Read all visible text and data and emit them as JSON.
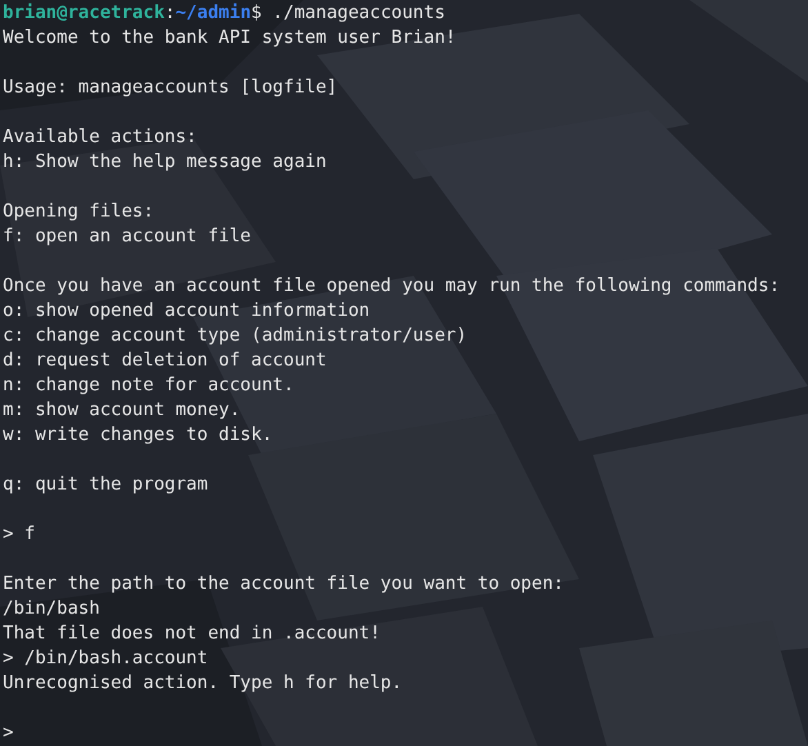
{
  "terminal": {
    "lines": [
      {
        "kind": "prompt",
        "user": "brian@racetrack",
        "separator": ":",
        "path": "~/admin",
        "symbol": "$",
        "command": " ./manageaccounts"
      },
      {
        "kind": "output",
        "text": "Welcome to the bank API system user Brian!"
      },
      {
        "kind": "blank"
      },
      {
        "kind": "output",
        "text": "Usage: manageaccounts [logfile]"
      },
      {
        "kind": "blank"
      },
      {
        "kind": "output",
        "text": "Available actions:"
      },
      {
        "kind": "output",
        "text": "h: Show the help message again"
      },
      {
        "kind": "blank"
      },
      {
        "kind": "output",
        "text": "Opening files:"
      },
      {
        "kind": "output",
        "text": "f: open an account file"
      },
      {
        "kind": "blank"
      },
      {
        "kind": "output",
        "text": "Once you have an account file opened you may run the following commands:"
      },
      {
        "kind": "output",
        "text": "o: show opened account information"
      },
      {
        "kind": "output",
        "text": "c: change account type (administrator/user)"
      },
      {
        "kind": "output",
        "text": "d: request deletion of account"
      },
      {
        "kind": "output",
        "text": "n: change note for account."
      },
      {
        "kind": "output",
        "text": "m: show account money."
      },
      {
        "kind": "output",
        "text": "w: write changes to disk."
      },
      {
        "kind": "blank"
      },
      {
        "kind": "output",
        "text": "q: quit the program"
      },
      {
        "kind": "blank"
      },
      {
        "kind": "output",
        "text": "> f"
      },
      {
        "kind": "blank"
      },
      {
        "kind": "output",
        "text": "Enter the path to the account file you want to open:"
      },
      {
        "kind": "output",
        "text": "/bin/bash"
      },
      {
        "kind": "output",
        "text": "That file does not end in .account!"
      },
      {
        "kind": "output",
        "text": "> /bin/bash.account"
      },
      {
        "kind": "output",
        "text": "Unrecognised action. Type h for help."
      },
      {
        "kind": "blank"
      },
      {
        "kind": "output",
        "text": ">"
      }
    ]
  }
}
